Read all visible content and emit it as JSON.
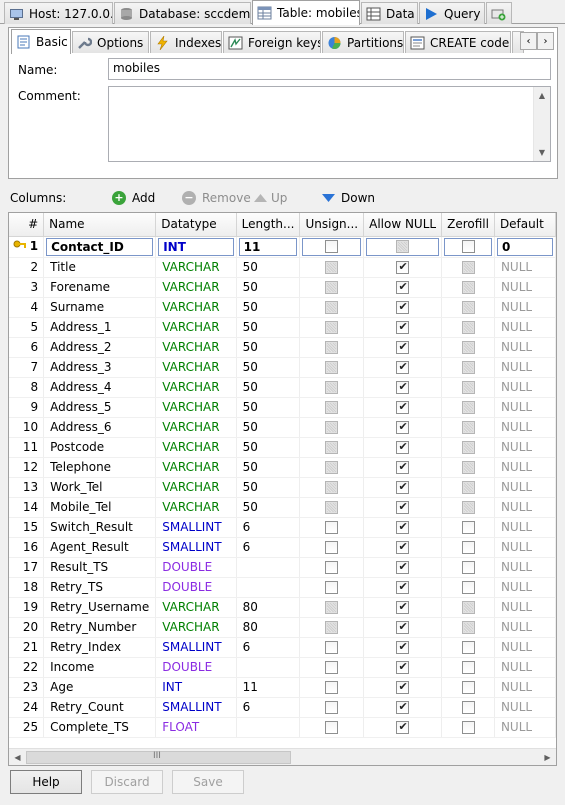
{
  "top_tabs": [
    {
      "label": "Host: 127.0.0.1",
      "icon": "host-icon"
    },
    {
      "label": "Database: sccdemo",
      "icon": "database-icon"
    },
    {
      "label": "Table: mobiles",
      "icon": "table-icon"
    },
    {
      "label": "Data",
      "icon": "data-grid-icon"
    },
    {
      "label": "Query",
      "icon": "play-icon"
    },
    {
      "label": "",
      "icon": "new-query-tab-icon"
    }
  ],
  "sub_tabs": [
    {
      "label": "Basic",
      "icon": "basic-icon"
    },
    {
      "label": "Options",
      "icon": "wrench-icon"
    },
    {
      "label": "Indexes",
      "icon": "lightning-icon"
    },
    {
      "label": "Foreign keys",
      "icon": "foreign-key-icon"
    },
    {
      "label": "Partitions",
      "icon": "pie-chart-icon"
    },
    {
      "label": "CREATE code",
      "icon": "code-icon"
    }
  ],
  "form": {
    "name_label": "Name:",
    "name_value": "mobiles",
    "comment_label": "Comment:",
    "comment_value": ""
  },
  "columns_toolbar": {
    "label": "Columns:",
    "add": "Add",
    "remove": "Remove",
    "up": "Up",
    "down": "Down"
  },
  "grid": {
    "headers": [
      "#",
      "Name",
      "Datatype",
      "Length...",
      "Unsign...",
      "Allow NULL",
      "Zerofill",
      "Default"
    ],
    "rows": [
      {
        "n": "1",
        "name": "Contact_ID",
        "type": "INT",
        "kind": "int",
        "length": "11",
        "unsigned": "off",
        "allow_null": "disabled",
        "zerofill": "off",
        "default": "0"
      },
      {
        "n": "2",
        "name": "Title",
        "type": "VARCHAR",
        "kind": "text",
        "length": "50",
        "unsigned": "disabled",
        "allow_null": "on",
        "zerofill": "disabled",
        "default": "NULL"
      },
      {
        "n": "3",
        "name": "Forename",
        "type": "VARCHAR",
        "kind": "text",
        "length": "50",
        "unsigned": "disabled",
        "allow_null": "on",
        "zerofill": "disabled",
        "default": "NULL"
      },
      {
        "n": "4",
        "name": "Surname",
        "type": "VARCHAR",
        "kind": "text",
        "length": "50",
        "unsigned": "disabled",
        "allow_null": "on",
        "zerofill": "disabled",
        "default": "NULL"
      },
      {
        "n": "5",
        "name": "Address_1",
        "type": "VARCHAR",
        "kind": "text",
        "length": "50",
        "unsigned": "disabled",
        "allow_null": "on",
        "zerofill": "disabled",
        "default": "NULL"
      },
      {
        "n": "6",
        "name": "Address_2",
        "type": "VARCHAR",
        "kind": "text",
        "length": "50",
        "unsigned": "disabled",
        "allow_null": "on",
        "zerofill": "disabled",
        "default": "NULL"
      },
      {
        "n": "7",
        "name": "Address_3",
        "type": "VARCHAR",
        "kind": "text",
        "length": "50",
        "unsigned": "disabled",
        "allow_null": "on",
        "zerofill": "disabled",
        "default": "NULL"
      },
      {
        "n": "8",
        "name": "Address_4",
        "type": "VARCHAR",
        "kind": "text",
        "length": "50",
        "unsigned": "disabled",
        "allow_null": "on",
        "zerofill": "disabled",
        "default": "NULL"
      },
      {
        "n": "9",
        "name": "Address_5",
        "type": "VARCHAR",
        "kind": "text",
        "length": "50",
        "unsigned": "disabled",
        "allow_null": "on",
        "zerofill": "disabled",
        "default": "NULL"
      },
      {
        "n": "10",
        "name": "Address_6",
        "type": "VARCHAR",
        "kind": "text",
        "length": "50",
        "unsigned": "disabled",
        "allow_null": "on",
        "zerofill": "disabled",
        "default": "NULL"
      },
      {
        "n": "11",
        "name": "Postcode",
        "type": "VARCHAR",
        "kind": "text",
        "length": "50",
        "unsigned": "disabled",
        "allow_null": "on",
        "zerofill": "disabled",
        "default": "NULL"
      },
      {
        "n": "12",
        "name": "Telephone",
        "type": "VARCHAR",
        "kind": "text",
        "length": "50",
        "unsigned": "disabled",
        "allow_null": "on",
        "zerofill": "disabled",
        "default": "NULL"
      },
      {
        "n": "13",
        "name": "Work_Tel",
        "type": "VARCHAR",
        "kind": "text",
        "length": "50",
        "unsigned": "disabled",
        "allow_null": "on",
        "zerofill": "disabled",
        "default": "NULL"
      },
      {
        "n": "14",
        "name": "Mobile_Tel",
        "type": "VARCHAR",
        "kind": "text",
        "length": "50",
        "unsigned": "disabled",
        "allow_null": "on",
        "zerofill": "disabled",
        "default": "NULL"
      },
      {
        "n": "15",
        "name": "Switch_Result",
        "type": "SMALLINT",
        "kind": "int",
        "length": "6",
        "unsigned": "off",
        "allow_null": "on",
        "zerofill": "off",
        "default": "NULL"
      },
      {
        "n": "16",
        "name": "Agent_Result",
        "type": "SMALLINT",
        "kind": "int",
        "length": "6",
        "unsigned": "off",
        "allow_null": "on",
        "zerofill": "off",
        "default": "NULL"
      },
      {
        "n": "17",
        "name": "Result_TS",
        "type": "DOUBLE",
        "kind": "real",
        "length": "",
        "unsigned": "off",
        "allow_null": "on",
        "zerofill": "off",
        "default": "NULL"
      },
      {
        "n": "18",
        "name": "Retry_TS",
        "type": "DOUBLE",
        "kind": "real",
        "length": "",
        "unsigned": "off",
        "allow_null": "on",
        "zerofill": "off",
        "default": "NULL"
      },
      {
        "n": "19",
        "name": "Retry_Username",
        "type": "VARCHAR",
        "kind": "text",
        "length": "80",
        "unsigned": "disabled",
        "allow_null": "on",
        "zerofill": "disabled",
        "default": "NULL"
      },
      {
        "n": "20",
        "name": "Retry_Number",
        "type": "VARCHAR",
        "kind": "text",
        "length": "80",
        "unsigned": "disabled",
        "allow_null": "on",
        "zerofill": "disabled",
        "default": "NULL"
      },
      {
        "n": "21",
        "name": "Retry_Index",
        "type": "SMALLINT",
        "kind": "int",
        "length": "6",
        "unsigned": "off",
        "allow_null": "on",
        "zerofill": "off",
        "default": "NULL"
      },
      {
        "n": "22",
        "name": "Income",
        "type": "DOUBLE",
        "kind": "real",
        "length": "",
        "unsigned": "off",
        "allow_null": "on",
        "zerofill": "off",
        "default": "NULL"
      },
      {
        "n": "23",
        "name": "Age",
        "type": "INT",
        "kind": "int",
        "length": "11",
        "unsigned": "off",
        "allow_null": "on",
        "zerofill": "off",
        "default": "NULL"
      },
      {
        "n": "24",
        "name": "Retry_Count",
        "type": "SMALLINT",
        "kind": "int",
        "length": "6",
        "unsigned": "off",
        "allow_null": "on",
        "zerofill": "off",
        "default": "NULL"
      },
      {
        "n": "25",
        "name": "Complete_TS",
        "type": "FLOAT",
        "kind": "real",
        "length": "",
        "unsigned": "off",
        "allow_null": "on",
        "zerofill": "off",
        "default": "NULL"
      }
    ],
    "scroll_grip": "III"
  },
  "buttons": {
    "help": "Help",
    "discard": "Discard",
    "save": "Save"
  },
  "colors": {
    "int_type": "#0000c8",
    "text_type": "#008000",
    "real_type": "#8a2be2",
    "null_text": "#9a9a9a",
    "selection_border": "#7b96c9"
  }
}
